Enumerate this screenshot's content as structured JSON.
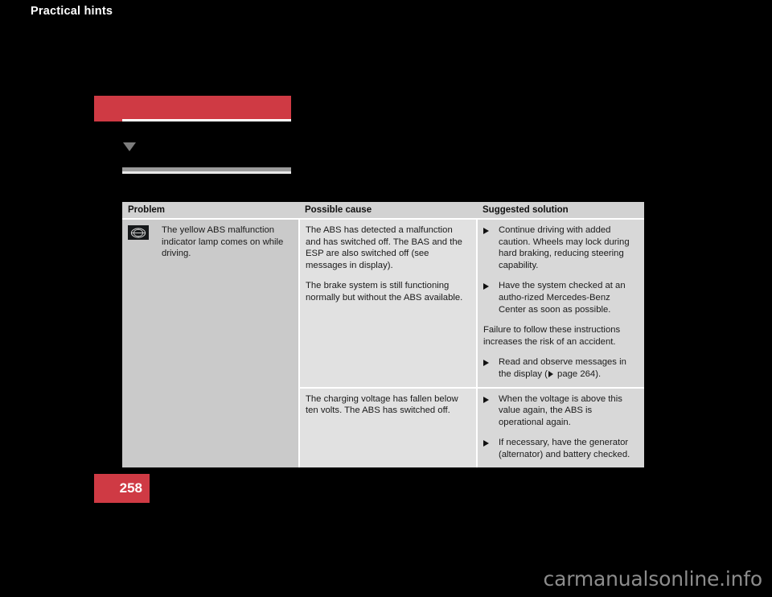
{
  "page": {
    "background_color": "#000000",
    "accent_color": "#cf3a44",
    "page_number": "258",
    "watermark": "carmanualsonline.info"
  },
  "section": {
    "title": "Practical hints",
    "marker_icon": "triangle-down-icon",
    "rule_bar_color": "#9b9b9b"
  },
  "table": {
    "headers": [
      "Problem",
      "Possible cause",
      "Suggested solution"
    ],
    "rows": [
      {
        "problem": {
          "lamp_icon": "abs-warning-lamp-icon",
          "text": "The yellow ABS malfunction indicator lamp comes on while driving."
        },
        "cause": [
          "The ABS has detected a malfunction and has switched off. The BAS and the ESP are also switched off (see messages in display).",
          "The brake system is still functioning normally but without the ABS available."
        ],
        "solution": {
          "bullets_before": [
            "Continue driving with added caution. Wheels may lock during hard braking, reducing steering capability.",
            "Have the system checked at an autho-rized Mercedes-Benz Center as soon as possible."
          ],
          "note": "Failure to follow these instructions increases the risk of an accident.",
          "bullets_after": [
            {
              "text_before_ref": "Read and observe messages in the display (",
              "ref": " page 264",
              "text_after_ref": ")."
            }
          ]
        }
      },
      {
        "problem": {
          "lamp_icon": "",
          "text": ""
        },
        "cause": [
          "The charging voltage has fallen below ten volts. The ABS has switched off."
        ],
        "solution": {
          "bullets_before": [
            "When the voltage is above this value again, the ABS is operational again.",
            "If necessary, have the generator (alternator) and battery checked."
          ],
          "note": "",
          "bullets_after": []
        }
      }
    ]
  }
}
